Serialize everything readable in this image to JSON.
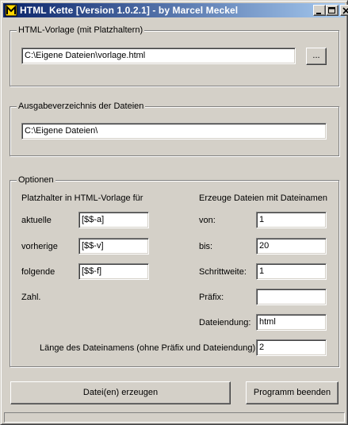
{
  "window": {
    "title": "HTML Kette [Version 1.0.2.1] - by Marcel Meckel",
    "minimize_glyph": "_",
    "maximize_glyph": "□",
    "close_glyph": "×"
  },
  "template_group": {
    "label": "HTML-Vorlage (mit Platzhaltern)",
    "path_value": "C:\\Eigene Dateien\\vorlage.html",
    "browse_label": "..."
  },
  "output_group": {
    "label": "Ausgabeverzeichnis der Dateien",
    "dir_value": "C:\\Eigene Dateien\\"
  },
  "options_group": {
    "label": "Optionen",
    "placeholders_heading": "Platzhalter in HTML-Vorlage für",
    "placeholders": [
      {
        "label": "aktuelle",
        "value": "[$$-a]"
      },
      {
        "label": "vorherige",
        "value": "[$$-v]"
      },
      {
        "label": "folgende",
        "value": "[$$-f]"
      }
    ],
    "zahl_label": "Zahl.",
    "generate_heading": "Erzeuge Dateien mit Dateinamen",
    "from_label": "von:",
    "from_value": "1",
    "to_label": "bis:",
    "to_value": "20",
    "step_label": "Schrittweite:",
    "step_value": "1",
    "prefix_label": "Präfix:",
    "prefix_value": "",
    "extension_label": "Dateiendung:",
    "extension_value": "html",
    "length_label": "Länge des Dateinamens (ohne Präfix und Dateiendung):",
    "length_value": "2"
  },
  "actions": {
    "generate_label": "Datei(en) erzeugen",
    "quit_label": "Programm beenden"
  },
  "icons": {
    "app": "app-icon",
    "minimize": "minimize-icon",
    "maximize": "maximize-icon",
    "close": "close-icon"
  }
}
